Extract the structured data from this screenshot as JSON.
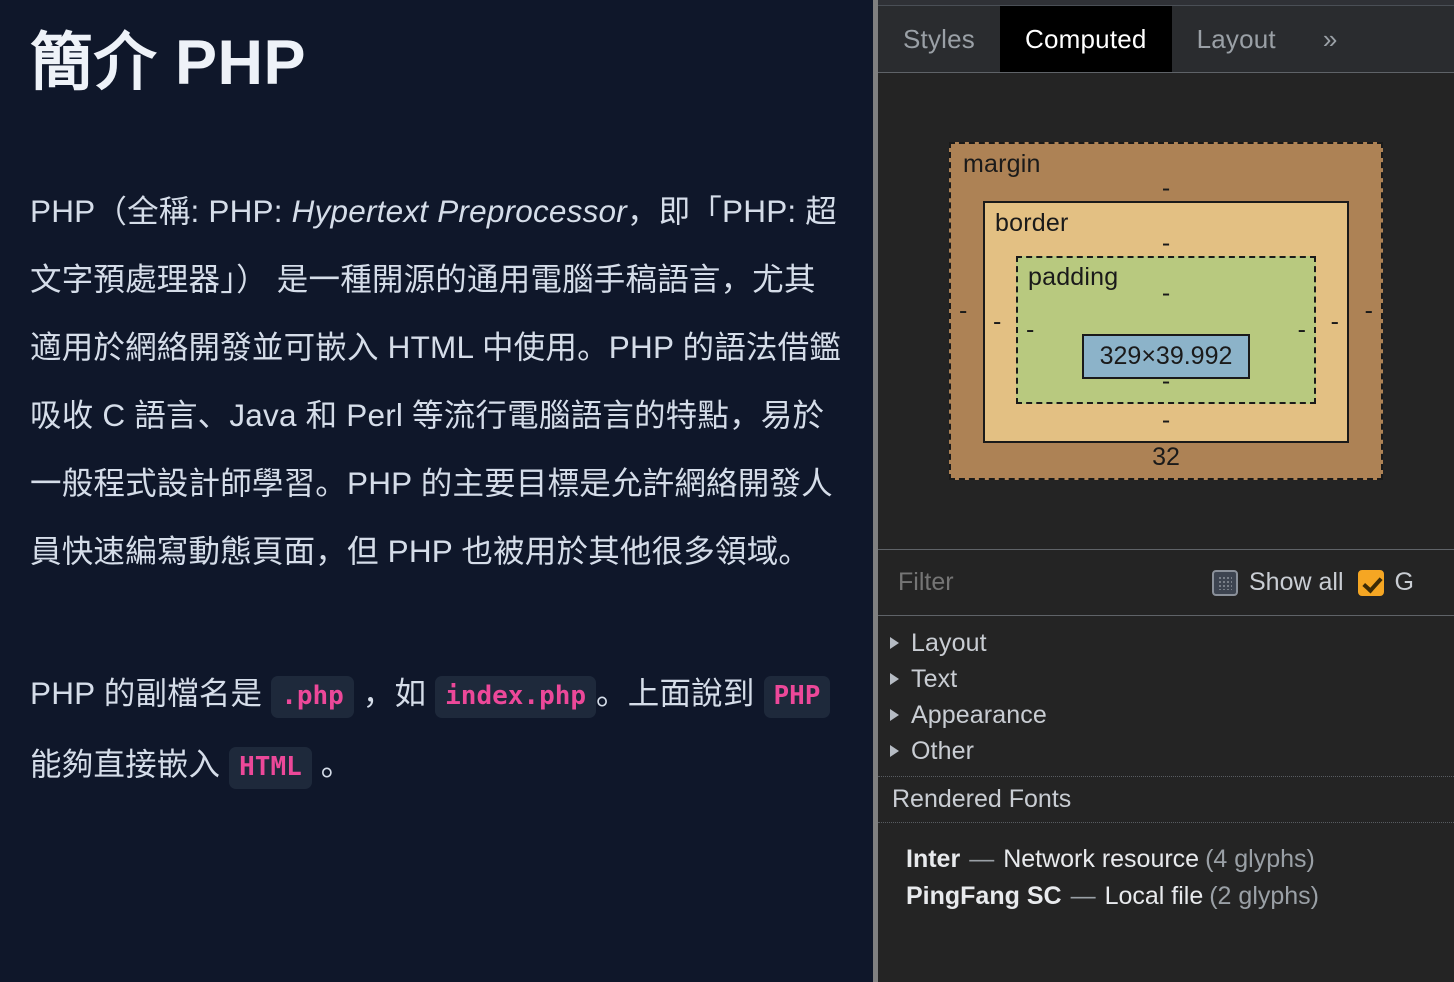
{
  "page": {
    "title": "簡介 PHP",
    "paragraph1": {
      "part1": "PHP（全稱: PHP: ",
      "italic": "Hypertext Preprocessor",
      "part2": "，即「PHP: 超文字預處理器」） 是一種開源的通用電腦手稿語言，尤其適用於網絡開發並可嵌入 HTML 中使用。PHP 的語法借鑑吸收 C 語言、Java 和 Perl 等流行電腦語言的特點，易於一般程式設計師學習。PHP 的主要目標是允許網絡開發人員快速編寫動態頁面，但 PHP 也被用於其他很多領域。"
    },
    "paragraph2": {
      "seg1": "PHP 的副檔名是 ",
      "code1": ".php",
      "seg2": " ，如 ",
      "code2": "index.php",
      "seg3": "。上面說到 ",
      "code3": "PHP",
      "seg4": " 能夠直接嵌入 ",
      "code4": "HTML",
      "seg5": " 。"
    }
  },
  "devtools": {
    "tabs": [
      {
        "label": "Styles",
        "selected": false
      },
      {
        "label": "Computed",
        "selected": true
      },
      {
        "label": "Layout",
        "selected": false
      }
    ],
    "more_tabs_icon": "»",
    "box_model": {
      "margin_label": "margin",
      "margin_top": "-",
      "margin_right": "-",
      "margin_bottom": "32",
      "margin_left": "-",
      "border_label": "border",
      "border_top": "-",
      "border_right": "-",
      "border_bottom": "-",
      "border_left": "-",
      "padding_label": "padding",
      "padding_top": "-",
      "padding_right": "-",
      "padding_bottom": "-",
      "padding_left": "-",
      "content_size": "329×39.992",
      "colors": {
        "margin": "#ad8255",
        "border": "#e3c083",
        "padding": "#b8c97f",
        "content": "#8cb3c9"
      }
    },
    "filter_bar": {
      "placeholder": "Filter",
      "value": "",
      "show_all_label": "Show all",
      "show_all_checked": false,
      "group_label": "G",
      "group_checked": true,
      "accent": "#f5a623"
    },
    "categories": [
      {
        "label": "Layout",
        "expanded": false
      },
      {
        "label": "Text",
        "expanded": false
      },
      {
        "label": "Appearance",
        "expanded": false
      },
      {
        "label": "Other",
        "expanded": false
      }
    ],
    "rendered_fonts": {
      "header": "Rendered Fonts",
      "items": [
        {
          "name": "Inter",
          "dash": "—",
          "origin": "Network resource",
          "glyphs": "(4 glyphs)"
        },
        {
          "name": "PingFang SC",
          "dash": "—",
          "origin": "Local file",
          "glyphs": "(2 glyphs)"
        }
      ]
    }
  }
}
